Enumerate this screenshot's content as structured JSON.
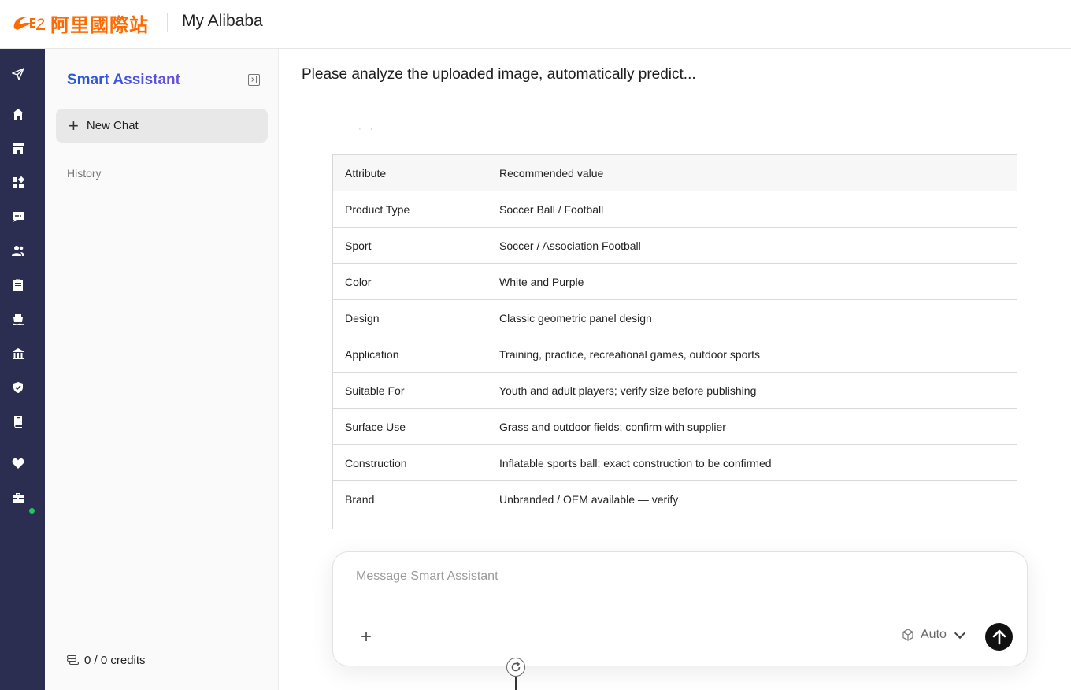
{
  "header": {
    "logo_text": "阿里國際站",
    "title": "My Alibaba"
  },
  "rail": {
    "icons": [
      "send-icon",
      "home-icon",
      "store-icon",
      "apps-icon",
      "message-icon",
      "users-icon",
      "orders-icon",
      "shipping-icon",
      "bank-icon",
      "shield-icon",
      "book-icon",
      "heart-icon",
      "briefcase-icon"
    ],
    "status_dot_color": "#22c55e"
  },
  "sidebar": {
    "title": "Smart Assistant",
    "new_chat_label": "New Chat",
    "history_label": "History",
    "credits": "0 / 0 credits"
  },
  "main": {
    "query": "Please analyze the uploaded image, automatically predict...",
    "table": {
      "headers": [
        "Attribute",
        "Recommended value"
      ],
      "rows": [
        [
          "Product Type",
          "Soccer Ball / Football"
        ],
        [
          "Sport",
          "Soccer / Association Football"
        ],
        [
          "Color",
          "White and Purple"
        ],
        [
          "Design",
          "Classic geometric panel design"
        ],
        [
          "Application",
          "Training, practice, recreational games, outdoor sports"
        ],
        [
          "Suitable For",
          "Youth and adult players; verify size before publishing"
        ],
        [
          "Surface Use",
          "Grass and outdoor fields; confirm with supplier"
        ],
        [
          "Construction",
          "Inflatable sports ball; exact construction to be confirmed"
        ],
        [
          "Brand",
          "Unbranded / OEM available — verify"
        ]
      ]
    }
  },
  "composer": {
    "placeholder": "Message Smart Assistant",
    "model_label": "Auto"
  },
  "colors": {
    "rail_bg": "#2b2d51",
    "brand_orange": "#ff6a00",
    "title_gradient_start": "#1e58d8",
    "title_gradient_end": "#6a4fe0"
  }
}
